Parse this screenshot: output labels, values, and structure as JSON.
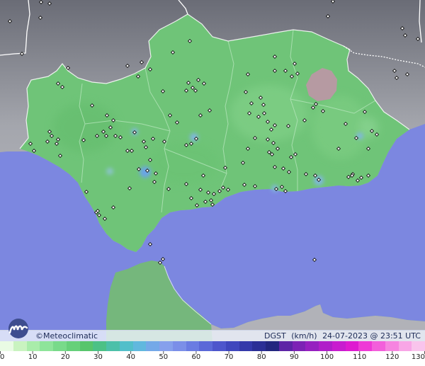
{
  "brand": {
    "name": "©Meteoclimatic",
    "logo": "meteoclimatic-logo-icon"
  },
  "product": {
    "variable": "DGST",
    "unit": "(km/h)",
    "timestamp": "24-07-2023 @ 23:51 UTC"
  },
  "colors": {
    "sea": "#7c87e0",
    "land_outside": "#a9aab0",
    "andalusia": "#6fc478",
    "morocco": "#75b77c",
    "border": "#ffffff",
    "high_zone": "#b69aa2",
    "station": "#111111"
  },
  "scale": {
    "labels": [
      "0",
      "10",
      "20",
      "30",
      "40",
      "50",
      "60",
      "70",
      "80",
      "90",
      "100",
      "110",
      "120",
      "130"
    ],
    "colors": [
      "#e9fbe4",
      "#c9f3c0",
      "#a9ecaa",
      "#8ee49a",
      "#78da8a",
      "#66d07a",
      "#57c56c",
      "#4cc186",
      "#4cc0a9",
      "#52bfca",
      "#61b8de",
      "#74a9e8",
      "#86a0ec",
      "#7b8fe8",
      "#6a7ce2",
      "#5b69d8",
      "#4d56cc",
      "#3f47bd",
      "#3439aa",
      "#2b2f96",
      "#22267f",
      "#5d24a6",
      "#7c22b5",
      "#9620c0",
      "#b01ec9",
      "#c81ccf",
      "#de1ad0",
      "#ee3ad6",
      "#f35fdb",
      "#f684e0",
      "#f8a6e6",
      "#f9c4ec"
    ]
  },
  "stations": [
    [
      14,
      30
    ],
    [
      58,
      3
    ],
    [
      70,
      5
    ],
    [
      57,
      25
    ],
    [
      31,
      76
    ],
    [
      470,
      2
    ],
    [
      463,
      23
    ],
    [
      568,
      40
    ],
    [
      572,
      50
    ],
    [
      590,
      55
    ],
    [
      557,
      100
    ],
    [
      575,
      105
    ],
    [
      560,
      110
    ],
    [
      268,
      58
    ],
    [
      244,
      74
    ],
    [
      200,
      88
    ],
    [
      96,
      96
    ],
    [
      82,
      118
    ],
    [
      88,
      123
    ],
    [
      180,
      93
    ],
    [
      212,
      98
    ],
    [
      195,
      108
    ],
    [
      280,
      113
    ],
    [
      266,
      117
    ],
    [
      272,
      124
    ],
    [
      263,
      128
    ],
    [
      276,
      128
    ],
    [
      288,
      118
    ],
    [
      230,
      129
    ],
    [
      130,
      149
    ],
    [
      151,
      163
    ],
    [
      160,
      170
    ],
    [
      156,
      180
    ],
    [
      146,
      186
    ],
    [
      150,
      192
    ],
    [
      137,
      192
    ],
    [
      163,
      192
    ],
    [
      170,
      194
    ],
    [
      190,
      187
    ],
    [
      203,
      200
    ],
    [
      206,
      208
    ],
    [
      216,
      196
    ],
    [
      180,
      213
    ],
    [
      186,
      213
    ],
    [
      212,
      226
    ],
    [
      240,
      163
    ],
    [
      250,
      173
    ],
    [
      283,
      163
    ],
    [
      296,
      156
    ],
    [
      232,
      200
    ],
    [
      263,
      205
    ],
    [
      277,
      196
    ],
    [
      270,
      203
    ],
    [
      208,
      241
    ],
    [
      196,
      239
    ],
    [
      220,
      245
    ],
    [
      70,
      186
    ],
    [
      73,
      192
    ],
    [
      67,
      200
    ],
    [
      82,
      197
    ],
    [
      80,
      203
    ],
    [
      43,
      203
    ],
    [
      48,
      213
    ],
    [
      85,
      220
    ],
    [
      118,
      198
    ],
    [
      122,
      271
    ],
    [
      136,
      300
    ],
    [
      140,
      304
    ],
    [
      148,
      309
    ],
    [
      138,
      298
    ],
    [
      160,
      293
    ],
    [
      183,
      266
    ],
    [
      218,
      257
    ],
    [
      238,
      267
    ],
    [
      263,
      260
    ],
    [
      270,
      280
    ],
    [
      278,
      290
    ],
    [
      283,
      268
    ],
    [
      294,
      272
    ],
    [
      302,
      274
    ],
    [
      298,
      283
    ],
    [
      290,
      285
    ],
    [
      300,
      289
    ],
    [
      310,
      270
    ],
    [
      315,
      265
    ],
    [
      322,
      268
    ],
    [
      345,
      261
    ],
    [
      360,
      263
    ],
    [
      390,
      267
    ],
    [
      398,
      264
    ],
    [
      403,
      270
    ],
    [
      287,
      248
    ],
    [
      318,
      237
    ],
    [
      343,
      230
    ],
    [
      388,
      236
    ],
    [
      400,
      238
    ],
    [
      408,
      243
    ],
    [
      432,
      246
    ],
    [
      445,
      248
    ],
    [
      450,
      254
    ],
    [
      498,
      246
    ],
    [
      510,
      251
    ],
    [
      520,
      248
    ],
    [
      355,
      146
    ],
    [
      368,
      138
    ],
    [
      372,
      148
    ],
    [
      352,
      160
    ],
    [
      365,
      165
    ],
    [
      373,
      160
    ],
    [
      378,
      172
    ],
    [
      383,
      183
    ],
    [
      388,
      177
    ],
    [
      378,
      197
    ],
    [
      386,
      202
    ],
    [
      392,
      210
    ],
    [
      380,
      215
    ],
    [
      384,
      218
    ],
    [
      407,
      178
    ],
    [
      430,
      170
    ],
    [
      442,
      152
    ],
    [
      446,
      147
    ],
    [
      456,
      157
    ],
    [
      388,
      80
    ],
    [
      388,
      100
    ],
    [
      403,
      100
    ],
    [
      416,
      90
    ],
    [
      412,
      108
    ],
    [
      420,
      104
    ],
    [
      350,
      105
    ],
    [
      347,
      130
    ],
    [
      360,
      195
    ],
    [
      350,
      210
    ],
    [
      417,
      218
    ],
    [
      411,
      222
    ],
    [
      478,
      210
    ],
    [
      488,
      175
    ],
    [
      503,
      195
    ],
    [
      505,
      255
    ],
    [
      492,
      250
    ],
    [
      497,
      248
    ],
    [
      515,
      158
    ],
    [
      525,
      185
    ],
    [
      532,
      190
    ],
    [
      520,
      210
    ],
    [
      212,
      345
    ],
    [
      226,
      371
    ],
    [
      230,
      366
    ],
    [
      444,
      367
    ]
  ]
}
